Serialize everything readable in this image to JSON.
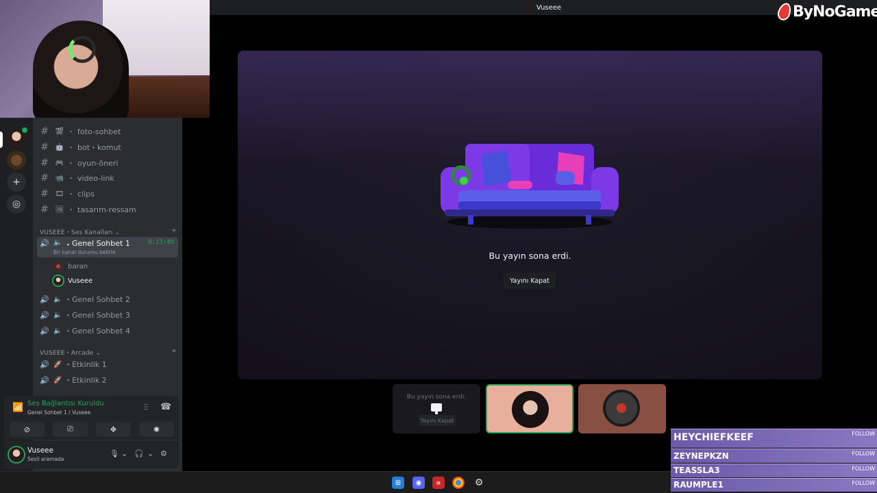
{
  "window_title": "Vuseee",
  "logo_text": "ByNoGame",
  "channels": [
    {
      "emoji": "🎬",
      "name": "foto-sohbet"
    },
    {
      "emoji": "🤖",
      "name": "bot・komut"
    },
    {
      "emoji": "🎮",
      "name": "oyun-öneri"
    },
    {
      "emoji": "📹",
      "name": "video-link"
    },
    {
      "emoji": "🎞",
      "name": "clips"
    },
    {
      "emoji": "🖼",
      "name": "tasarım-ressam"
    }
  ],
  "categories": {
    "voice": "VUSEEE・Ses Kanalları",
    "arcade": "VUSEEE・Arcade"
  },
  "voice_channels": [
    {
      "name": "Genel Sohbet 1",
      "timer": "8:13:49",
      "status": "Bir kanal durumu belirle"
    },
    {
      "name": "Genel Sohbet 2"
    },
    {
      "name": "Genel Sohbet 3"
    },
    {
      "name": "Genel Sohbet 4"
    }
  ],
  "members": [
    {
      "name": "baran"
    },
    {
      "name": "Vuseee"
    }
  ],
  "arcade_channels": [
    {
      "name": "Etkinlik 1"
    },
    {
      "name": "Etkinlik 2"
    }
  ],
  "voice_panel": {
    "connected": "Ses Bağlantısı Kuruldu",
    "location": "Genel Sohbet 1 / Vuseee"
  },
  "user": {
    "name": "Vuseee",
    "status": "Sesli aramada"
  },
  "stage": {
    "message": "Bu yayın sona erdi.",
    "close_button": "Yayını Kapat"
  },
  "tile1": {
    "message": "Bu yayın sona erdi.",
    "close_button": "Yayını Kapat"
  },
  "followers": [
    {
      "name": "HEYCHIEFKEEF",
      "label": "FOLLOW"
    },
    {
      "name": "ZEYNEPKZN",
      "label": "FOLLOW"
    },
    {
      "name": "TEASSLA3",
      "label": "FOLLOW"
    },
    {
      "name": "RAUMPLE1",
      "label": "FOLLOW"
    }
  ],
  "colors": {
    "accent_green": "#23a55a",
    "sidebar_bg": "#2b2d31",
    "rail_bg": "#1e1f22",
    "follower_bg": "#7c6bb8"
  }
}
